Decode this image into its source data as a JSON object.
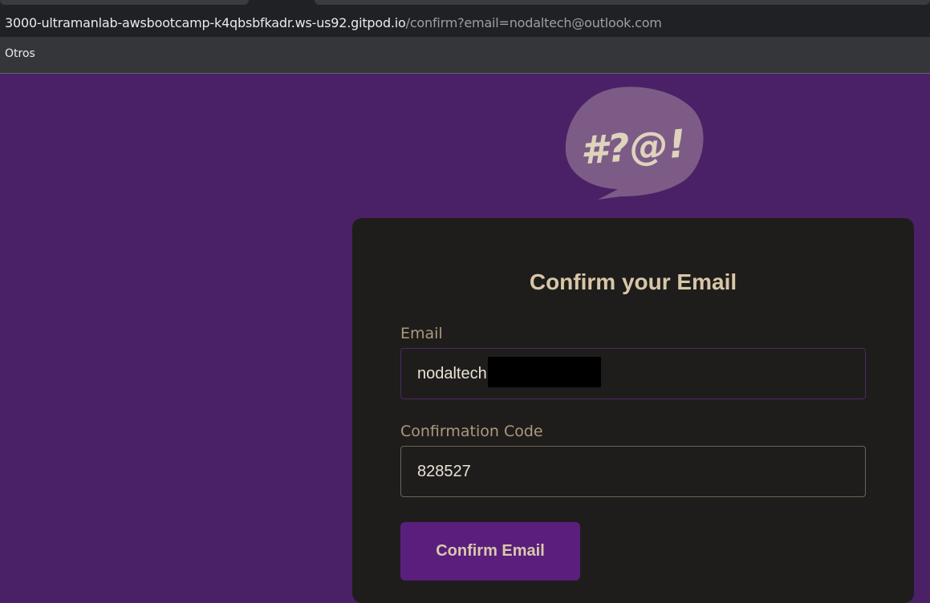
{
  "browser": {
    "url_host": "3000-ultramanlab-awsbootcamp-k4qbsbfkadr.ws-us92.gitpod.io",
    "url_path": "/confirm?email=nodaltech@outlook.com",
    "bookmarks": [
      "Otros"
    ]
  },
  "logo": {
    "text": "#?@!",
    "icon": "speech-bubble-icon"
  },
  "form": {
    "title": "Confirm your Email",
    "email_label": "Email",
    "email_value": "nodaltech",
    "code_label": "Confirmation Code",
    "code_value": "828527",
    "submit_label": "Confirm Email"
  },
  "colors": {
    "page_background": "#4a2166",
    "card_background": "#1f1d1b",
    "accent": "#5a1f7c",
    "text_primary": "#d7c7a8",
    "label": "#a89a7c",
    "logo_bubble": "#7c5c86",
    "logo_text": "#ded3bc"
  }
}
